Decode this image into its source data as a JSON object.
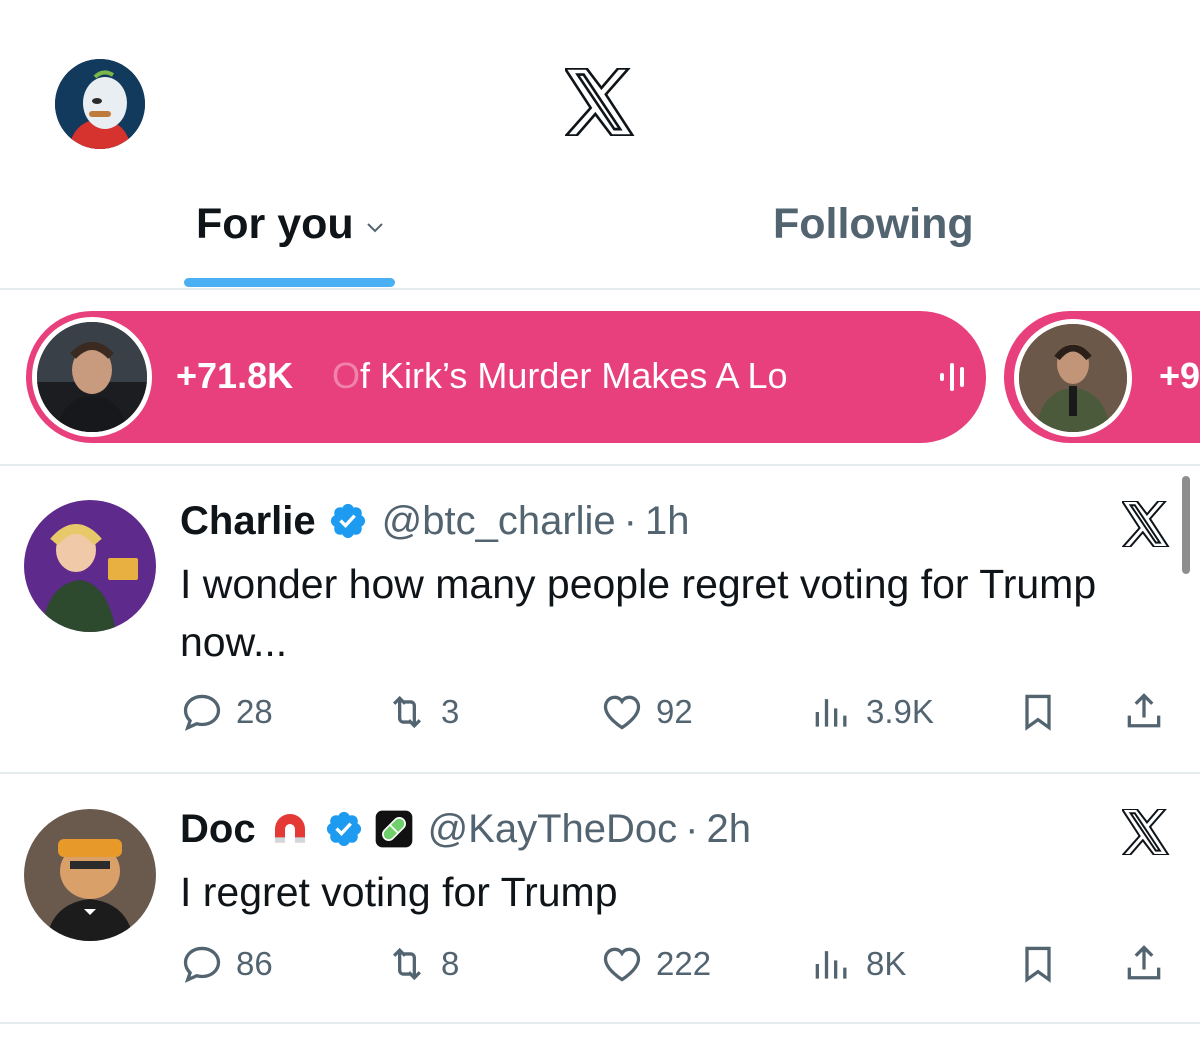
{
  "header": {
    "tabs": [
      {
        "label": "For you",
        "active": true
      },
      {
        "label": "Following",
        "active": false
      }
    ]
  },
  "spaces": [
    {
      "count": "+71.8K",
      "title_start": "O",
      "title": "f Kirk’s Murder Makes A Lo"
    },
    {
      "count": "+9"
    }
  ],
  "tweets": [
    {
      "name": "Charlie",
      "handle": "@btc_charlie",
      "dot": "·",
      "time": "1h",
      "text": "I wonder how many people regret voting for Trump now...",
      "replies": "28",
      "reposts": "3",
      "likes": "92",
      "views": "3.9K"
    },
    {
      "name": "Doc",
      "handle": "@KayTheDoc",
      "dot": "·",
      "time": "2h",
      "text": "I regret voting for Trump",
      "replies": "86",
      "reposts": "8",
      "likes": "222",
      "views": "8K"
    }
  ],
  "colors": {
    "accent": "#1d9bf0",
    "spaces_pink": "#e8407c",
    "secondary_text": "#536471",
    "verified_blue": "#1d9bf0"
  },
  "icons": [
    "x-logo-icon",
    "chevron-down-icon",
    "audio-wave-icon",
    "verified-badge-icon",
    "magnet-icon",
    "pill-icon",
    "reply-icon",
    "repost-icon",
    "like-icon",
    "views-icon",
    "bookmark-icon",
    "share-icon"
  ]
}
